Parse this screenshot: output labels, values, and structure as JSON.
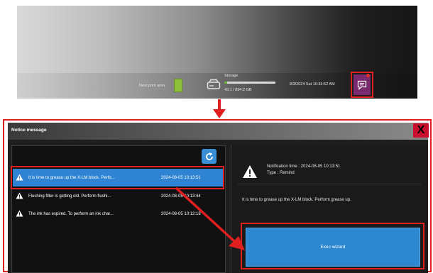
{
  "status_bar": {
    "next_print_label": "Next print area",
    "storage_label": "Storage",
    "storage_value": "49.1 / 894.2 GB",
    "storage_used_fraction": 0.055,
    "datetime": "8/3/2024 Sat 10:33:52 AM",
    "icons": [
      "drive-icon",
      "message-icon"
    ]
  },
  "dialog": {
    "title": "Notice message",
    "close_label": "X",
    "items": [
      {
        "message": "It is time to grease up the X-LM block. Perfo...",
        "time": "2024-08-05 10:13:51",
        "icon": "warning-icon"
      },
      {
        "message": "Flushing filter is getting old. Perform flushi...",
        "time": "2024-08-05 10:13:44",
        "icon": "warning-icon"
      },
      {
        "message": "The ink has expired. To perform an ink char...",
        "time": "2024-08-05 10:12:18",
        "icon": "warning-icon"
      }
    ],
    "detail": {
      "notification_time": "Notification time : 2024-08-05 10:13:51",
      "type": "Type : Remind",
      "message": "It is time to grease up the X-LM block. Perform grease up."
    },
    "exec_label": "Exec wizard"
  },
  "colors": {
    "accent": "#2e84d2",
    "highlight_frame": "#e02020",
    "close": "#c8102e",
    "notification_button": "#7a2a6e"
  }
}
